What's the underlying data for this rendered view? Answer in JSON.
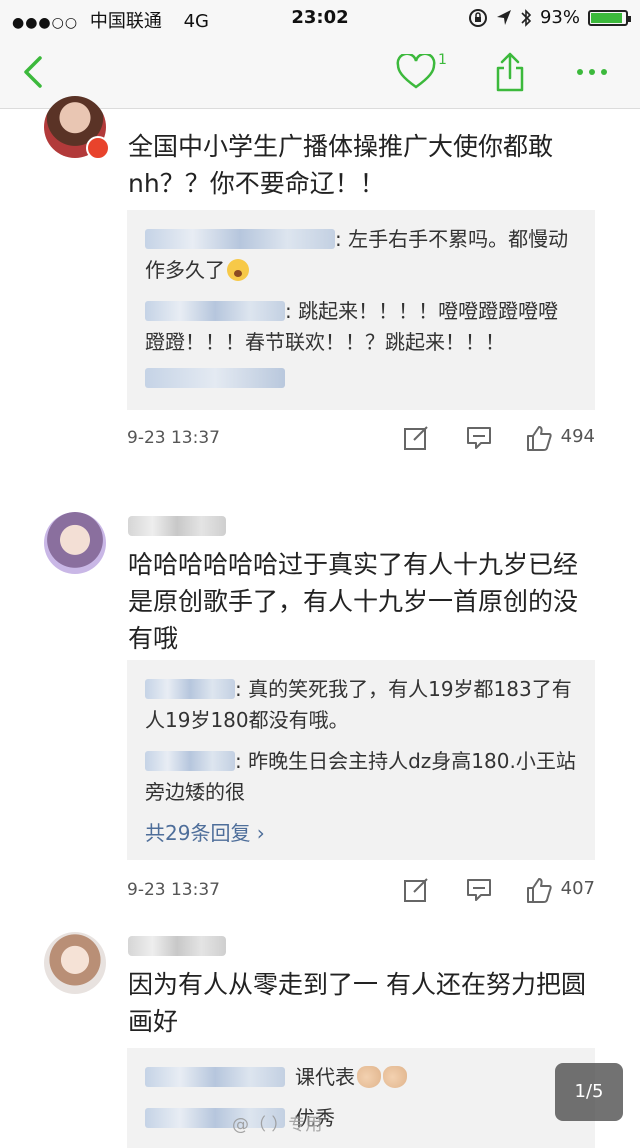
{
  "status_bar": {
    "carrier": "中国联通",
    "network": "4G",
    "time": "23:02",
    "battery": "93%",
    "battery_level": 0.93
  },
  "nav": {
    "like_count": "1"
  },
  "comments": [
    {
      "text": "全国中小学生广播体操推广大使你都敢nh？？你不要命辽！！",
      "replies": [
        {
          "text": ": 左手右手不累吗。都慢动作多久了"
        },
        {
          "text": ": 跳起来！！！！噔噔蹬蹬噔噔蹬蹬！！！春节联欢！！？跳起来！！！"
        }
      ],
      "time": "9-23 13:37",
      "likes": "494"
    },
    {
      "text": "哈哈哈哈哈哈过于真实了有人十九岁已经是原创歌手了，有人十九岁一首原创的没有哦",
      "replies": [
        {
          "text": ": 真的笑死我了，有人19岁都183了有人19岁180都没有哦。"
        },
        {
          "text": ": 昨晚生日会主持人dz身高180.小王站旁边矮的很"
        }
      ],
      "more": "共29条回复 ›",
      "time": "9-23 13:37",
      "likes": "407"
    },
    {
      "text": "因为有人从零走到了一 有人还在努力把圆画好",
      "replies": [
        {
          "text": "课代表"
        },
        {
          "text": "优秀"
        }
      ]
    }
  ],
  "pager": "1/5",
  "watermark": "@（ ）专用",
  "colors": {
    "accent": "#3cb93c",
    "link": "#4e6e9a",
    "reply_bg": "#f2f2f2"
  },
  "icons": [
    "back-icon",
    "heart-icon",
    "share-icon",
    "more-icon",
    "edit-icon",
    "comment-icon",
    "thumb-up-icon"
  ]
}
